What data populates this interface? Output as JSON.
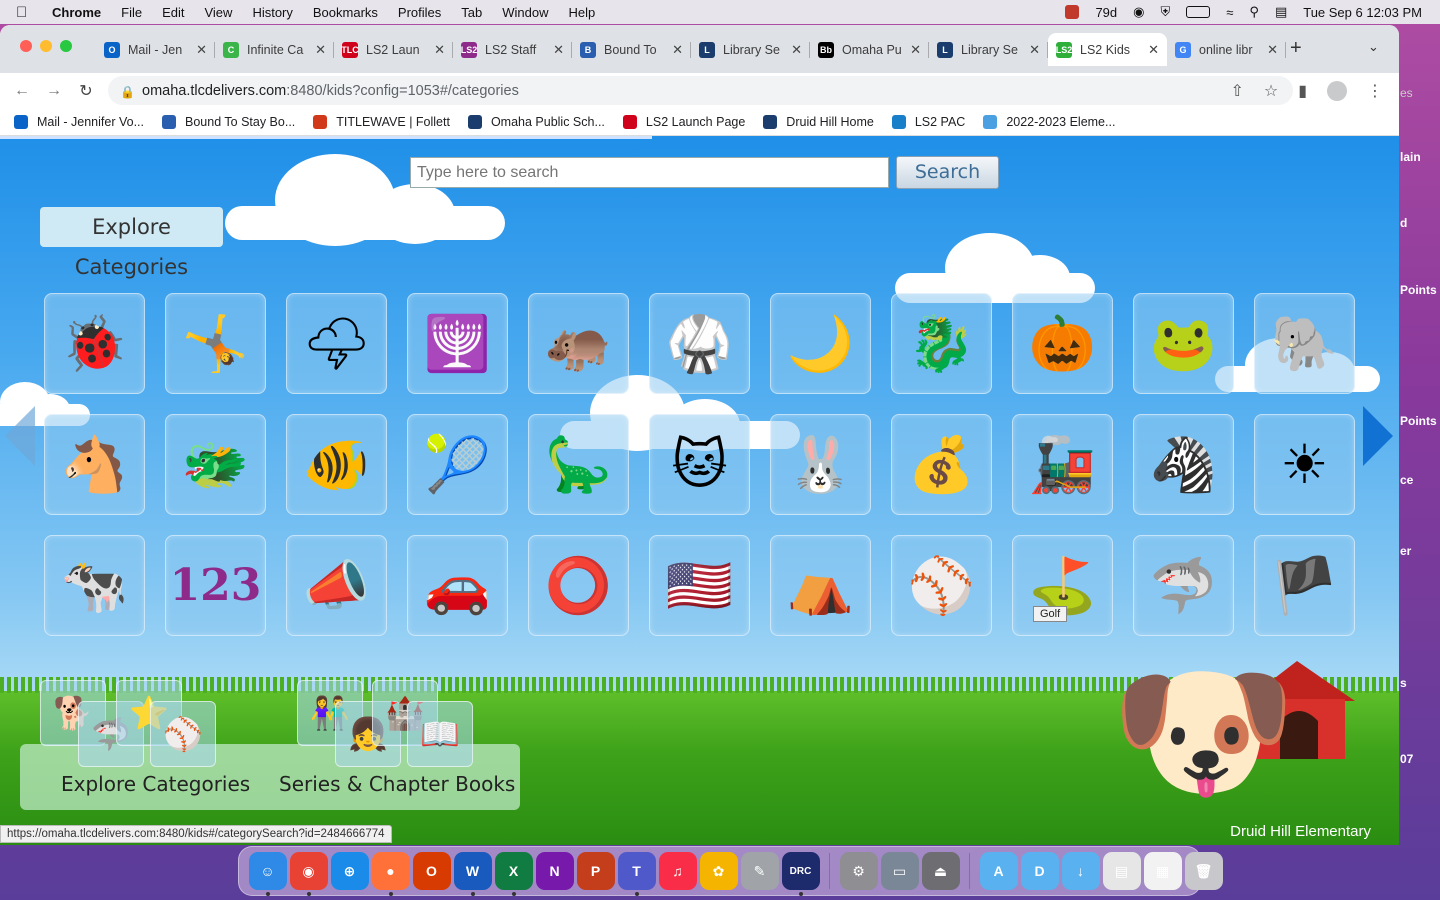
{
  "menubar": {
    "app": "Chrome",
    "items": [
      "File",
      "Edit",
      "View",
      "History",
      "Bookmarks",
      "Profiles",
      "Tab",
      "Window",
      "Help"
    ],
    "temperature": "79d",
    "datetime": "Tue Sep 6  12:03 PM"
  },
  "tabs": [
    {
      "title": "Mail - Jen",
      "color": "#0a64c8",
      "glyph": "O"
    },
    {
      "title": "Infinite Ca",
      "color": "#3bb54a",
      "glyph": "C"
    },
    {
      "title": "LS2 Laun",
      "color": "#d0021b",
      "glyph": "TLC"
    },
    {
      "title": "LS2 Staff",
      "color": "#8e2a8a",
      "glyph": "LS2"
    },
    {
      "title": "Bound To",
      "color": "#2a5fb0",
      "glyph": "B"
    },
    {
      "title": "Library Se",
      "color": "#1a3d6e",
      "glyph": "L"
    },
    {
      "title": "Omaha Pu",
      "color": "#000000",
      "glyph": "Bb"
    },
    {
      "title": "Library Se",
      "color": "#1a3d6e",
      "glyph": "L"
    },
    {
      "title": "LS2 Kids",
      "color": "#2fae3a",
      "glyph": "LS2",
      "active": true
    },
    {
      "title": "online libr",
      "color": "#4285f4",
      "glyph": "G"
    }
  ],
  "address": {
    "host": "omaha.tlcdelivers.com",
    "path": ":8480/kids?config=1053#/categories"
  },
  "bookmarks": [
    {
      "label": "Mail - Jennifer Vo...",
      "color": "#0a64c8"
    },
    {
      "label": "Bound To Stay Bo...",
      "color": "#2a5fb0"
    },
    {
      "label": "TITLEWAVE | Follett",
      "color": "#d03a1a"
    },
    {
      "label": "Omaha Public Sch...",
      "color": "#1a3d6e"
    },
    {
      "label": "LS2 Launch Page",
      "color": "#d0021b"
    },
    {
      "label": "Druid Hill Home",
      "color": "#1a3d6e"
    },
    {
      "label": "LS2 PAC",
      "color": "#1a7fc9"
    },
    {
      "label": "2022-2023 Eleme...",
      "color": "#4aa0e0"
    }
  ],
  "page": {
    "search_placeholder": "Type here to search",
    "search_button": "Search",
    "explore_badge": "Explore Categories",
    "tooltip": "Golf",
    "bottom_explore": "Explore Categories",
    "bottom_series": "Series & Chapter Books",
    "school": "Druid Hill Elementary",
    "status_url": "https://omaha.tlcdelivers.com:8480/kids#/categorySearch?id=2484666774"
  },
  "categories": [
    {
      "icon": "ladybug-icon",
      "glyph": "🐞"
    },
    {
      "icon": "gymnast-icon",
      "glyph": "🤸"
    },
    {
      "icon": "storm-cloud-icon",
      "glyph": "🌩"
    },
    {
      "icon": "kinara-icon",
      "glyph": "🕎"
    },
    {
      "icon": "hippo-icon",
      "glyph": "🦛"
    },
    {
      "icon": "karate-icon",
      "glyph": "🥋"
    },
    {
      "icon": "moon-clouds-icon",
      "glyph": "🌙"
    },
    {
      "icon": "dragon-purple-icon",
      "glyph": "🐉"
    },
    {
      "icon": "pumpkin-icon",
      "glyph": "🎃"
    },
    {
      "icon": "frog-icon",
      "glyph": "🐸"
    },
    {
      "icon": "elephant-icon",
      "glyph": "🐘"
    },
    {
      "icon": "horse-icon",
      "glyph": "🐴"
    },
    {
      "icon": "dragon-green-icon",
      "glyph": "🐲"
    },
    {
      "icon": "fish-icon",
      "glyph": "🐠"
    },
    {
      "icon": "tennis-icon",
      "glyph": "🎾"
    },
    {
      "icon": "dinosaur-icon",
      "glyph": "🦕"
    },
    {
      "icon": "cat-icon",
      "glyph": "🐱"
    },
    {
      "icon": "rabbit-icon",
      "glyph": "🐰"
    },
    {
      "icon": "money-icon",
      "glyph": "💰"
    },
    {
      "icon": "train-icon",
      "glyph": "🚂"
    },
    {
      "icon": "zebra-icon",
      "glyph": "🦓"
    },
    {
      "icon": "sun-icon",
      "glyph": "☀"
    },
    {
      "icon": "cow-icon",
      "glyph": "🐄"
    },
    {
      "icon": "numbers-icon",
      "glyph": "123"
    },
    {
      "icon": "cheerleader-icon",
      "glyph": "📣"
    },
    {
      "icon": "car-icon",
      "glyph": "🚗"
    },
    {
      "icon": "olympic-rings-icon",
      "glyph": "⭕"
    },
    {
      "icon": "american-flag-icon",
      "glyph": "🇺🇸"
    },
    {
      "icon": "pyramid-icon",
      "glyph": "⛺"
    },
    {
      "icon": "baseball-icon",
      "glyph": "⚾"
    },
    {
      "icon": "golf-icon",
      "glyph": "⛳"
    },
    {
      "icon": "shark-icon",
      "glyph": "🦈"
    },
    {
      "icon": "pirate-icon",
      "glyph": "🏴"
    }
  ],
  "desktop_slivers": [
    "es",
    "lain",
    "d",
    "Points",
    "Points",
    "ce",
    "er",
    "s",
    "07"
  ],
  "dock": [
    {
      "name": "finder",
      "color": "#2e8ae6",
      "glyph": "☺"
    },
    {
      "name": "chrome",
      "color": "#e84235",
      "glyph": "◉"
    },
    {
      "name": "safari",
      "color": "#1a8be8",
      "glyph": "⊕"
    },
    {
      "name": "firefox",
      "color": "#ff7139",
      "glyph": "●"
    },
    {
      "name": "office",
      "color": "#d83b01",
      "glyph": "O"
    },
    {
      "name": "word",
      "color": "#185abd",
      "glyph": "W"
    },
    {
      "name": "excel",
      "color": "#107c41",
      "glyph": "X"
    },
    {
      "name": "onenote",
      "color": "#7719aa",
      "glyph": "N"
    },
    {
      "name": "powerpoint",
      "color": "#c43e1c",
      "glyph": "P"
    },
    {
      "name": "teams",
      "color": "#5059c9",
      "glyph": "T"
    },
    {
      "name": "music",
      "color": "#fa2d48",
      "glyph": "♫"
    },
    {
      "name": "photos",
      "color": "#f5b400",
      "glyph": "✿"
    },
    {
      "name": "script-editor",
      "color": "#a0a4a8",
      "glyph": "✎"
    },
    {
      "name": "drc-insight",
      "color": "#1d2a6b",
      "glyph": "DRC"
    },
    {
      "name": "system-preferences",
      "color": "#8e8e93",
      "glyph": "⚙"
    },
    {
      "name": "screenshot",
      "color": "#7a8796",
      "glyph": "▭"
    },
    {
      "name": "utility",
      "color": "#6d6d72",
      "glyph": "⏏"
    },
    {
      "name": "applications-folder",
      "color": "#59b1ef",
      "glyph": "A"
    },
    {
      "name": "documents-folder",
      "color": "#59b1ef",
      "glyph": "D"
    },
    {
      "name": "downloads-folder",
      "color": "#59b1ef",
      "glyph": "↓"
    },
    {
      "name": "recent-window",
      "color": "#e6e6e6",
      "glyph": "▤"
    },
    {
      "name": "recent-window-2",
      "color": "#f2f2f2",
      "glyph": "▦"
    },
    {
      "name": "trash",
      "color": "#c7c7cc",
      "glyph": "🗑"
    }
  ]
}
